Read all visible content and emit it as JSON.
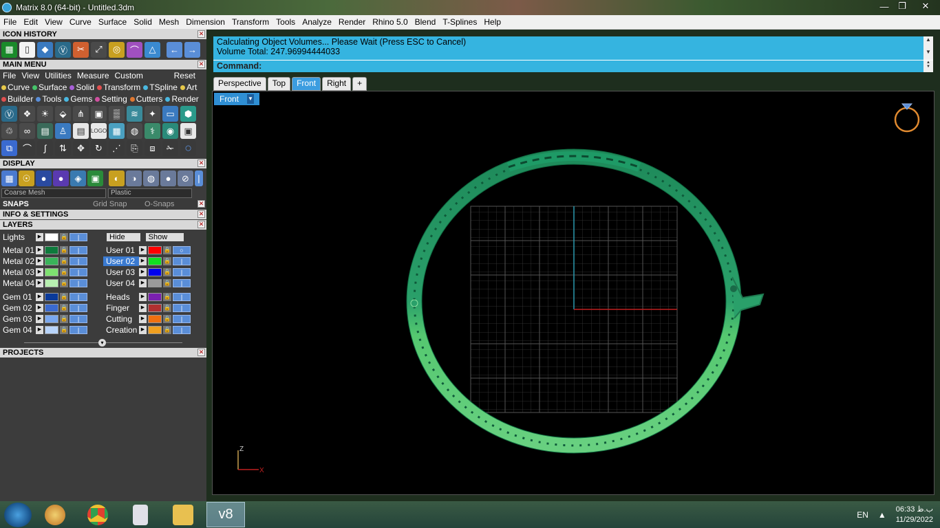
{
  "window": {
    "title": "Matrix 8.0 (64-bit) - Untitled.3dm",
    "controls": [
      "—",
      "❐",
      "✕"
    ]
  },
  "menubar": [
    "File",
    "Edit",
    "View",
    "Curve",
    "Surface",
    "Solid",
    "Mesh",
    "Dimension",
    "Transform",
    "Tools",
    "Analyze",
    "Render",
    "Rhino 5.0",
    "Blend",
    "T-Splines",
    "Help"
  ],
  "panels": {
    "icon_history": "ICON HISTORY",
    "main_menu": "MAIN MENU",
    "display": "DISPLAY",
    "snaps": "SNAPS",
    "grid_snap": "Grid Snap",
    "osnaps": "O-Snaps",
    "info_settings": "INFO & SETTINGS",
    "layers": "LAYERS",
    "projects": "PROJECTS"
  },
  "main_menu_items": [
    "File",
    "View",
    "Utilities",
    "Measure",
    "Custom"
  ],
  "main_menu_reset": "Reset",
  "category_row1": [
    {
      "label": "Curve",
      "color": "#e6c84a"
    },
    {
      "label": "Surface",
      "color": "#46c46a"
    },
    {
      "label": "Solid",
      "color": "#a860d8"
    },
    {
      "label": "Transform",
      "color": "#e05050"
    },
    {
      "label": "TSpline",
      "color": "#4ab8e0"
    },
    {
      "label": "Art",
      "color": "#e6c84a"
    }
  ],
  "category_row2": [
    {
      "label": "Builder",
      "color": "#e05050"
    },
    {
      "label": "Tools",
      "color": "#5a8ed8"
    },
    {
      "label": "Gems",
      "color": "#4ab8e0"
    },
    {
      "label": "Setting",
      "color": "#d050a0"
    },
    {
      "label": "Cutters",
      "color": "#e07830"
    },
    {
      "label": "Render",
      "color": "#4ab8e0"
    }
  ],
  "display_dropdowns": {
    "mesh": "Coarse Mesh",
    "material": "Plastic"
  },
  "layers": {
    "lights_label": "Lights",
    "hide_label": "Hide",
    "show_label": "Show",
    "left": [
      {
        "name": "Metal 01",
        "color": "#0e7a3c"
      },
      {
        "name": "Metal 02",
        "color": "#3ab35a"
      },
      {
        "name": "Metal 03",
        "color": "#7ee070"
      },
      {
        "name": "Metal 04",
        "color": "#b8f0b0"
      },
      {
        "name": "Gem 01",
        "color": "#0a3a9a"
      },
      {
        "name": "Gem 02",
        "color": "#3a6ad0"
      },
      {
        "name": "Gem 03",
        "color": "#7aa8f0"
      },
      {
        "name": "Gem 04",
        "color": "#b8d4fa"
      }
    ],
    "right": [
      {
        "name": "User 01",
        "color": "#ff0000"
      },
      {
        "name": "User 02",
        "color": "#10e020"
      },
      {
        "name": "User 03",
        "color": "#0000ee"
      },
      {
        "name": "User 04",
        "color": "#9a9a9a"
      },
      {
        "name": "Heads",
        "color": "#7a20b0"
      },
      {
        "name": "Finger",
        "color": "#b03030"
      },
      {
        "name": "Cutting",
        "color": "#f07010"
      },
      {
        "name": "Creation",
        "color": "#f0a020"
      }
    ]
  },
  "command": {
    "line1": "Calculating Object Volumes... Please Wait (Press ESC to Cancel)",
    "line2": "Volume Total: 247.96994444033",
    "prompt": "Command:"
  },
  "viewport_tabs": [
    "Perspective",
    "Top",
    "Front",
    "Right",
    "+"
  ],
  "active_viewport": "Front",
  "axis_labels": {
    "z": "Z",
    "x": "X"
  },
  "taskbar": {
    "language": "EN",
    "time": "06:33 ب.ظ",
    "date": "11/29/2022",
    "active_app": "v8"
  }
}
